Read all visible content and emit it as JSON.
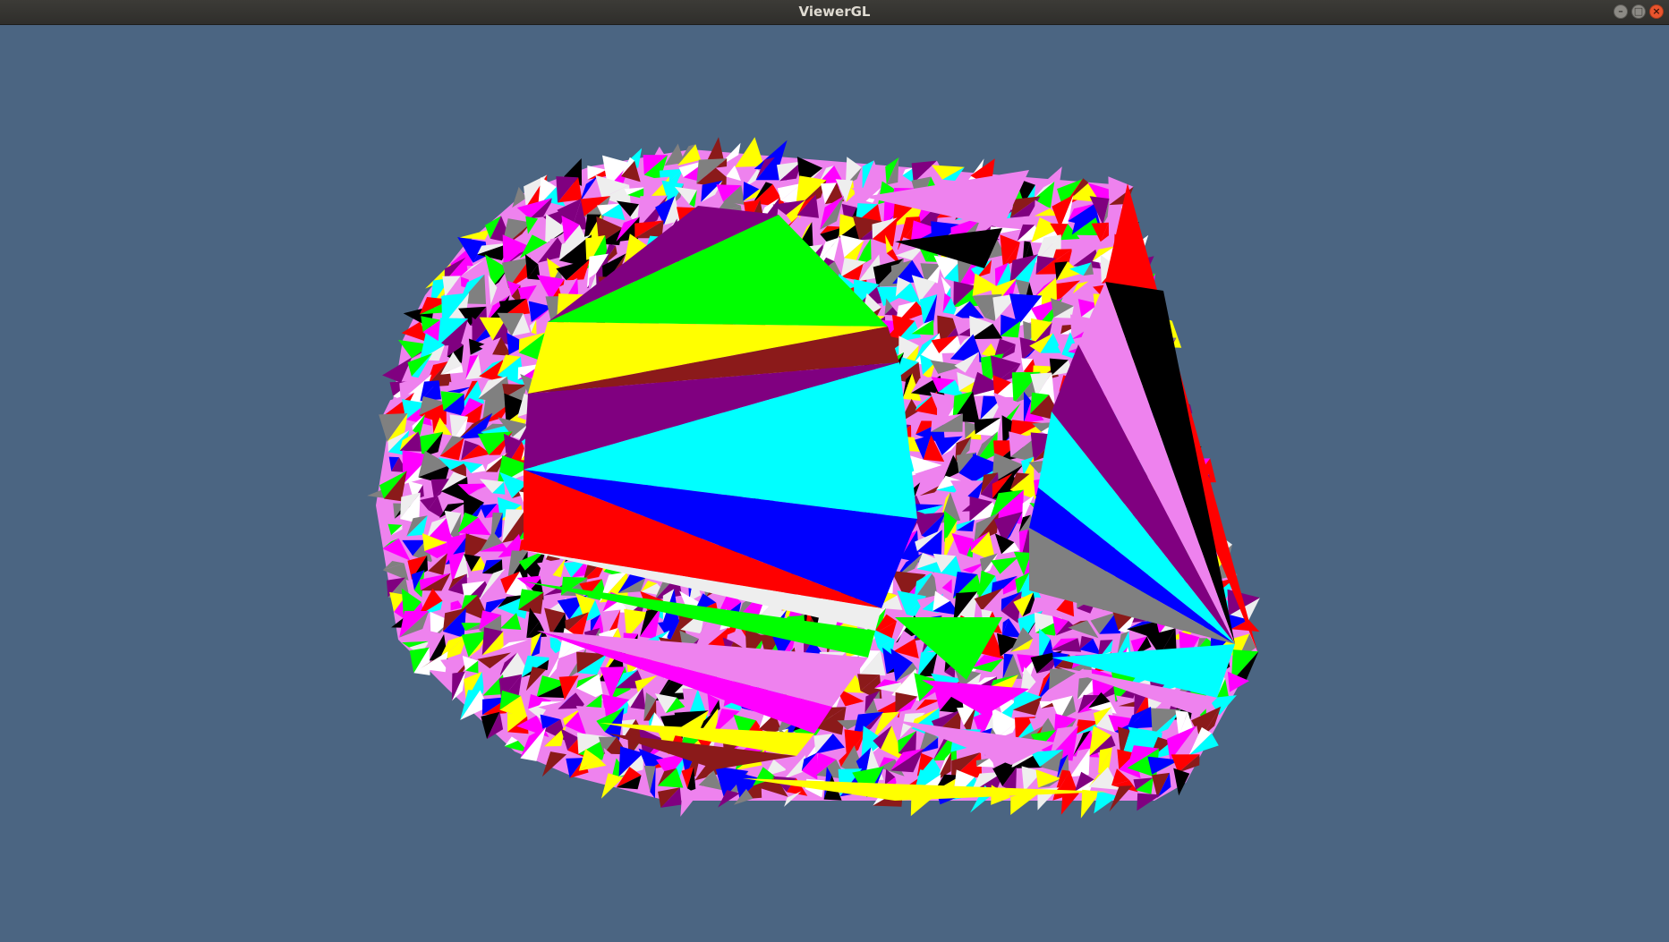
{
  "window": {
    "title": "ViewerGL",
    "controls": {
      "minimize_icon": "minimize-icon",
      "maximize_icon": "maximize-icon",
      "close_icon": "close-icon"
    }
  },
  "viewport": {
    "background_color": "#4b6582",
    "palette": [
      "#ff00ff",
      "#00ff00",
      "#0000ff",
      "#ff0000",
      "#ffff00",
      "#00ffff",
      "#000000",
      "#ffffff",
      "#808080",
      "#800080",
      "#8b1a1a",
      "#ee82ee",
      "#eeeeee"
    ]
  }
}
